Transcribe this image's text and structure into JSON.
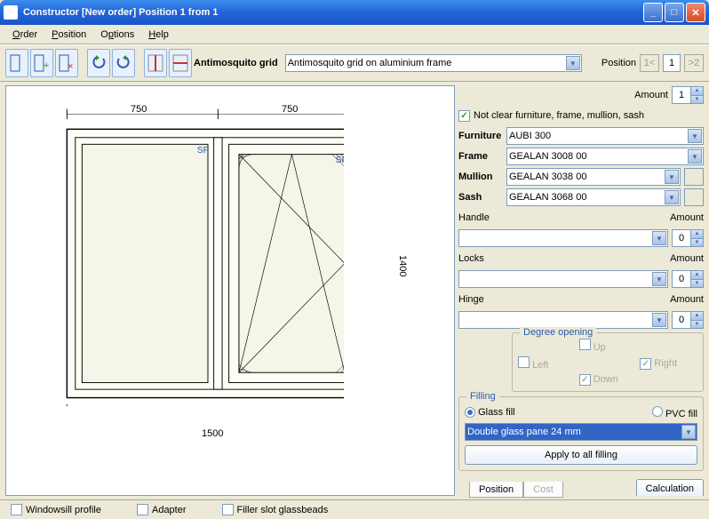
{
  "window": {
    "title": "Constructor [New order] Position 1 from 1"
  },
  "menu": {
    "order": "Order",
    "position": "Position",
    "options": "Options",
    "help": "Help"
  },
  "toolbar": {
    "antimosquito_label": "Antimosquito grid",
    "antimosquito_value": "Antimosquito grid on aluminium frame",
    "position_label": "Position",
    "prev": "1<",
    "current": "1",
    "next": ">2"
  },
  "drawing": {
    "dim_left_half": "750",
    "dim_right_half": "750",
    "dim_height": "1400",
    "dim_width": "1500"
  },
  "side": {
    "amount_label": "Amount",
    "amount_value": "1",
    "not_clear_label": "Not clear furniture, frame, mullion, sash",
    "furniture_label": "Furniture",
    "furniture_value": "AUBI 300",
    "frame_label": "Frame",
    "frame_value": "GEALAN 3008 00",
    "mullion_label": "Mullion",
    "mullion_value": "GEALAN 3038 00",
    "sash_label": "Sash",
    "sash_value": "GEALAN 3068 00",
    "handle_label": "Handle",
    "handle_amount_label": "Amount",
    "handle_amount": "0",
    "locks_label": "Locks",
    "locks_amount_label": "Amount",
    "locks_amount": "0",
    "hinge_label": "Hinge",
    "hinge_amount_label": "Amount",
    "hinge_amount": "0",
    "degree_legend": "Degree opening",
    "left": "Left",
    "right": "Right",
    "up": "Up",
    "down": "Down",
    "filling_legend": "Filling",
    "glass_fill": "Glass fill",
    "pvc_fill": "PVC fill",
    "glass_value": "Double glass pane 24 mm",
    "apply_all": "Apply to all filling",
    "calculation": "Calculation"
  },
  "bottom": {
    "windowsill": "Windowsill profile",
    "adapter": "Adapter",
    "filler": "Filler slot glassbeads",
    "tab_position": "Position",
    "tab_cost": "Cost"
  }
}
